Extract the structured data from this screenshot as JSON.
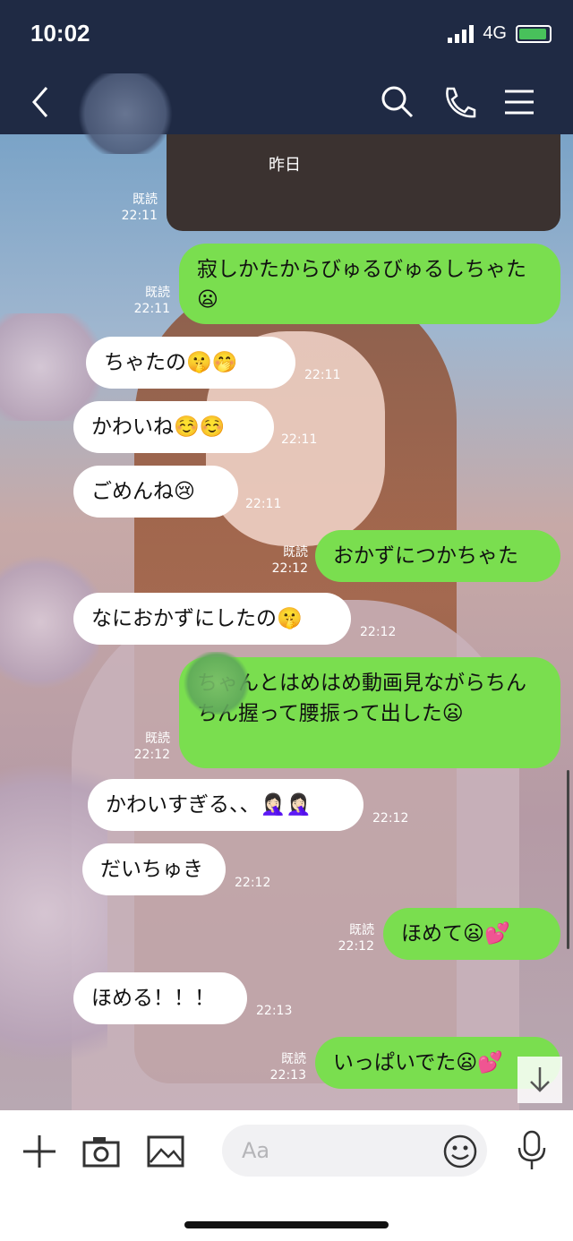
{
  "status_bar": {
    "time": "10:02",
    "network": "4G"
  },
  "header": {
    "back_icon": "chevron-left-icon",
    "search_icon": "search-icon",
    "call_icon": "phone-icon",
    "menu_icon": "menu-icon"
  },
  "photo_caption": "昨日",
  "messages": [
    {
      "side": "out",
      "read": "既読",
      "time": "22:11",
      "text": ""
    },
    {
      "side": "out",
      "read": "既読",
      "time": "22:11",
      "text": "寂しかたからびゅるびゅるしちゃた😦"
    },
    {
      "side": "in",
      "time": "22:11",
      "text": "ちゃたの🤫🤭"
    },
    {
      "side": "in",
      "time": "22:11",
      "text": "かわいね☺️☺️"
    },
    {
      "side": "in",
      "time": "22:11",
      "text": "ごめんね😢"
    },
    {
      "side": "out",
      "read": "既読",
      "time": "22:12",
      "text": "おかずにつかちゃた"
    },
    {
      "side": "in",
      "time": "22:12",
      "text": "なにおかずにしたの🤫"
    },
    {
      "side": "out",
      "read": "既読",
      "time": "22:12",
      "text": "ちゃんとはめはめ動画見ながらちんちん握って腰振って出した😦"
    },
    {
      "side": "in",
      "time": "22:12",
      "text": "かわいすぎる、、🤦🏻‍♀️🤦🏻‍♀️"
    },
    {
      "side": "in",
      "time": "22:12",
      "text": "だいちゅき"
    },
    {
      "side": "out",
      "read": "既読",
      "time": "22:12",
      "text": "ほめて😦💕"
    },
    {
      "side": "in",
      "time": "22:13",
      "text": "ほめる！！！"
    },
    {
      "side": "out",
      "read": "既読",
      "time": "22:13",
      "text": "いっぱいでた😦💕"
    }
  ],
  "input": {
    "placeholder": "Aa"
  },
  "footer_icons": [
    "plus-icon",
    "camera-icon",
    "image-icon",
    "emoji-icon",
    "microphone-icon"
  ],
  "colors": {
    "header": "#1f2a44",
    "out_bubble": "#7ade4f",
    "in_bubble": "#ffffff"
  }
}
